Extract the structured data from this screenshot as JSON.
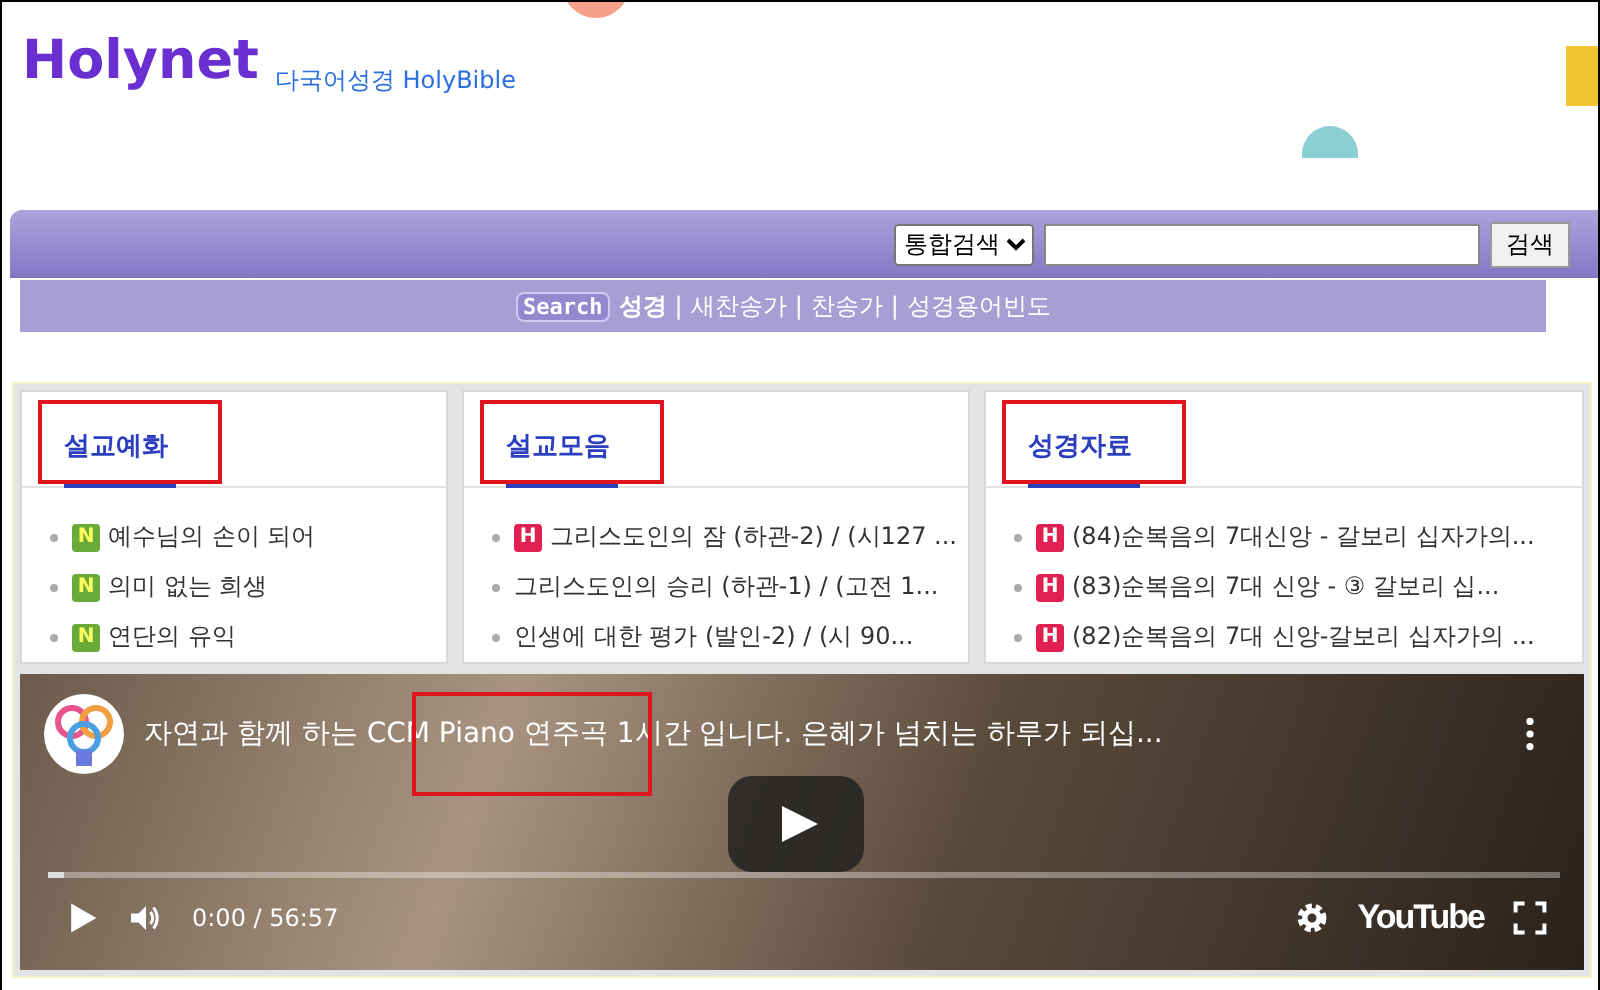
{
  "header": {
    "logo": "Holynet",
    "tagline": "다국어성경 HolyBible"
  },
  "search": {
    "scope": "통합검색",
    "button": "검색"
  },
  "quick_links": {
    "badge": "Search",
    "links": [
      {
        "label": "성경",
        "bold": true
      },
      {
        "label": "새찬송가",
        "bold": false
      },
      {
        "label": "찬송가",
        "bold": false
      },
      {
        "label": "성경용어빈도",
        "bold": false
      }
    ],
    "separator": "|"
  },
  "columns": [
    {
      "title": "설교예화",
      "highlighted": true,
      "items": [
        {
          "badge": "N",
          "text": "예수님의 손이 되어"
        },
        {
          "badge": "N",
          "text": "의미 없는 희생"
        },
        {
          "badge": "N",
          "text": "연단의 유익"
        }
      ]
    },
    {
      "title": "설교모음",
      "highlighted": true,
      "items": [
        {
          "badge": "H",
          "text": "그리스도인의 잠 (하관-2) / (시127 ..."
        },
        {
          "text": "그리스도인의 승리 (하관-1) / (고전 1..."
        },
        {
          "text": "인생에 대한 평가 (발인-2) / (시 90..."
        }
      ]
    },
    {
      "title": "성경자료",
      "highlighted": true,
      "items": [
        {
          "badge": "H",
          "text": "(84)순복음의 7대신앙 - 갈보리 십자가의..."
        },
        {
          "badge": "H",
          "text": "(83)순복음의 7대 신앙 - ③ 갈보리 십..."
        },
        {
          "badge": "H",
          "text": "(82)순복음의 7대 신앙-갈보리 십자가의 ..."
        }
      ]
    }
  ],
  "video": {
    "title": "자연과 함께 하는 CCM Piano 연주곡 1시간 입니다. 은혜가 넘치는 하루가 되십...",
    "title_highlighted": true,
    "time": "0:00 / 56:57",
    "brand": "YouTube",
    "level": 0.01
  }
}
